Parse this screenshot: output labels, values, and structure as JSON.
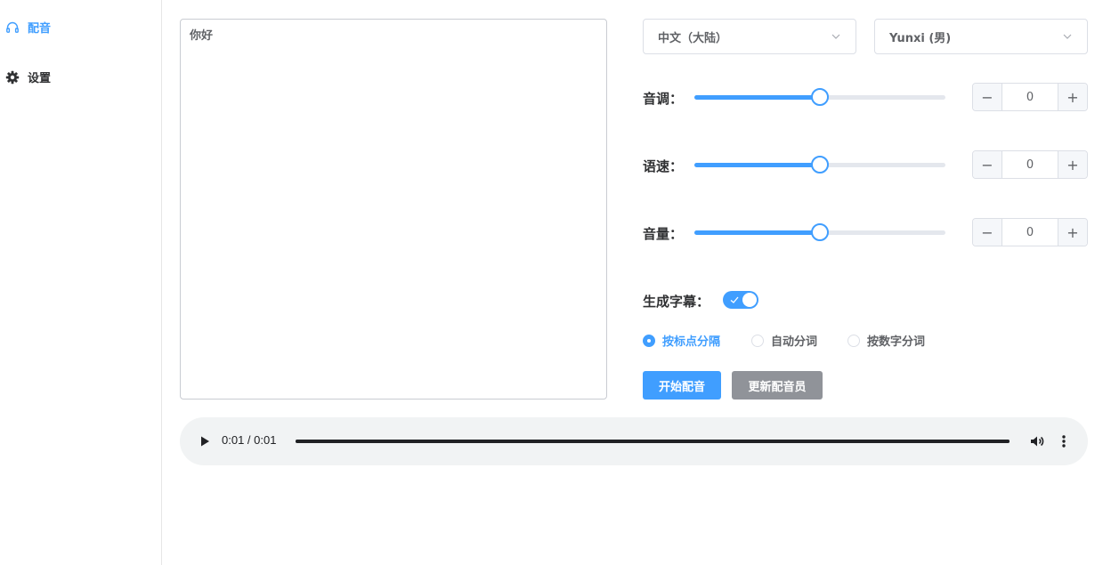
{
  "sidebar": {
    "items": [
      {
        "label": "配音",
        "icon": "headphones-icon",
        "active": true
      },
      {
        "label": "设置",
        "icon": "gear-icon",
        "active": false
      }
    ]
  },
  "editor": {
    "text": "你好"
  },
  "language_select": {
    "value": "中文（大陆）"
  },
  "voice_select": {
    "value": "Yunxi (男)"
  },
  "controls": {
    "pitch": {
      "label": "音调：",
      "value": "0",
      "slider_fraction": 0.5
    },
    "rate": {
      "label": "语速：",
      "value": "0",
      "slider_fraction": 0.5
    },
    "volume": {
      "label": "音量：",
      "value": "0",
      "slider_fraction": 0.5
    }
  },
  "subtitle": {
    "label": "生成字幕：",
    "enabled": true
  },
  "split_modes": [
    {
      "label": "按标点分隔",
      "checked": true
    },
    {
      "label": "自动分词",
      "checked": false
    },
    {
      "label": "按数字分词",
      "checked": false
    }
  ],
  "actions": {
    "start_label": "开始配音",
    "update_label": "更新配音员"
  },
  "player": {
    "time": "0:01 / 0:01",
    "progress_fraction": 1.0
  },
  "colors": {
    "accent": "#409eff",
    "gray_button": "#909399"
  }
}
